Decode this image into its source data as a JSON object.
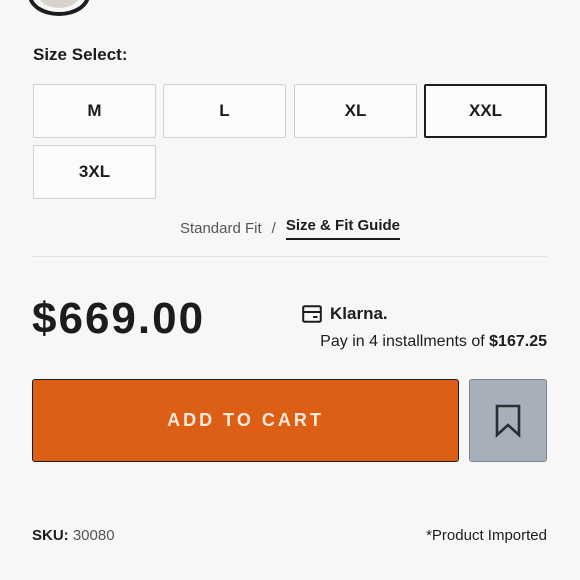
{
  "size_section": {
    "label": "Size Select:",
    "options": [
      "M",
      "L",
      "XL",
      "XXL",
      "3XL"
    ],
    "selected": "XXL"
  },
  "fit": {
    "standard": "Standard Fit",
    "separator": "/",
    "guide_link": "Size & Fit Guide"
  },
  "pricing": {
    "price": "$669.00",
    "klarna_brand": "Klarna.",
    "installment_prefix": "Pay in 4 installments of",
    "installment_amount": "$167.25"
  },
  "actions": {
    "add_to_cart": "ADD TO CART",
    "wishlist_icon": "bookmark-icon"
  },
  "footer": {
    "sku_label": "SKU:",
    "sku_value": "30080",
    "imported_note": "*Product Imported"
  },
  "colors": {
    "accent": "#dd5f16",
    "wishlist_bg": "#a7b0ba",
    "text": "#1c1c1c"
  }
}
